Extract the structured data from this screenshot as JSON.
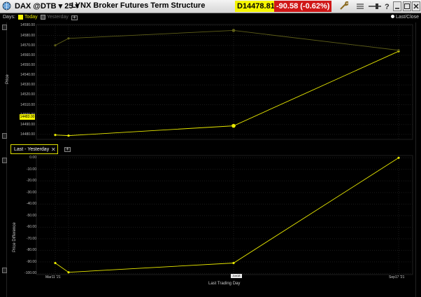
{
  "titlebar": {
    "symbol": "DAX @DTB ▾ 25 ▾",
    "title": "LYNX Broker  Futures Term Structure",
    "price": "D14478.81",
    "change": "-90.58 (-0.62%)"
  },
  "toolbar": {
    "days_label": "Days:",
    "today_label": "Today",
    "yesterday_label": "Yesterday",
    "last_close_label": "Last/Close"
  },
  "colors": {
    "today": "#e8e800",
    "yesterday": "#5e5e18",
    "price_bg": "#f5f500",
    "change_bg": "#d01818"
  },
  "top_chart": {
    "ylabel": "Price",
    "yticks": [
      "14590.00",
      "14580.00",
      "14570.00",
      "14560.00",
      "14550.00",
      "14540.00",
      "14530.00",
      "14520.00",
      "14510.00",
      "14500.00",
      "14490.00",
      "14480.00"
    ],
    "current_price_tag": "14483.00"
  },
  "legend": {
    "label": "Last - Yesterday"
  },
  "bottom_chart": {
    "ylabel": "Price Difference",
    "xlabel": "Last Trading Day",
    "yticks": [
      "0.00",
      "-10.00",
      "-20.00",
      "-30.00",
      "-40.00",
      "-50.00",
      "-60.00",
      "-70.00",
      "-80.00",
      "-90.00",
      "-100.00"
    ],
    "xticks": [
      "Mar11 '21",
      "Jun18 '21",
      "Sep17 '21"
    ]
  },
  "chart_data": [
    {
      "type": "line",
      "ylabel": "Price",
      "ylim": [
        14475,
        14591
      ],
      "x": [
        "Mar11 '21",
        "Mar19 '21",
        "Jun18 '21",
        "Sep17 '21"
      ],
      "series": [
        {
          "name": "Today",
          "values": [
            14479.5,
            14478.8,
            14488.7,
            14564.0
          ]
        },
        {
          "name": "Yesterday",
          "values": [
            14570.0,
            14577.0,
            14585.0,
            14565.0
          ]
        }
      ]
    },
    {
      "type": "line",
      "ylabel": "Price Difference",
      "xlabel": "Last Trading Day",
      "ylim": [
        -101,
        2
      ],
      "x": [
        "Mar11 '21",
        "Mar19 '21",
        "Jun18 '21",
        "Sep17 '21"
      ],
      "series": [
        {
          "name": "Last - Yesterday",
          "values": [
            -91.0,
            -99.0,
            -91.0,
            0.0
          ]
        }
      ]
    }
  ]
}
